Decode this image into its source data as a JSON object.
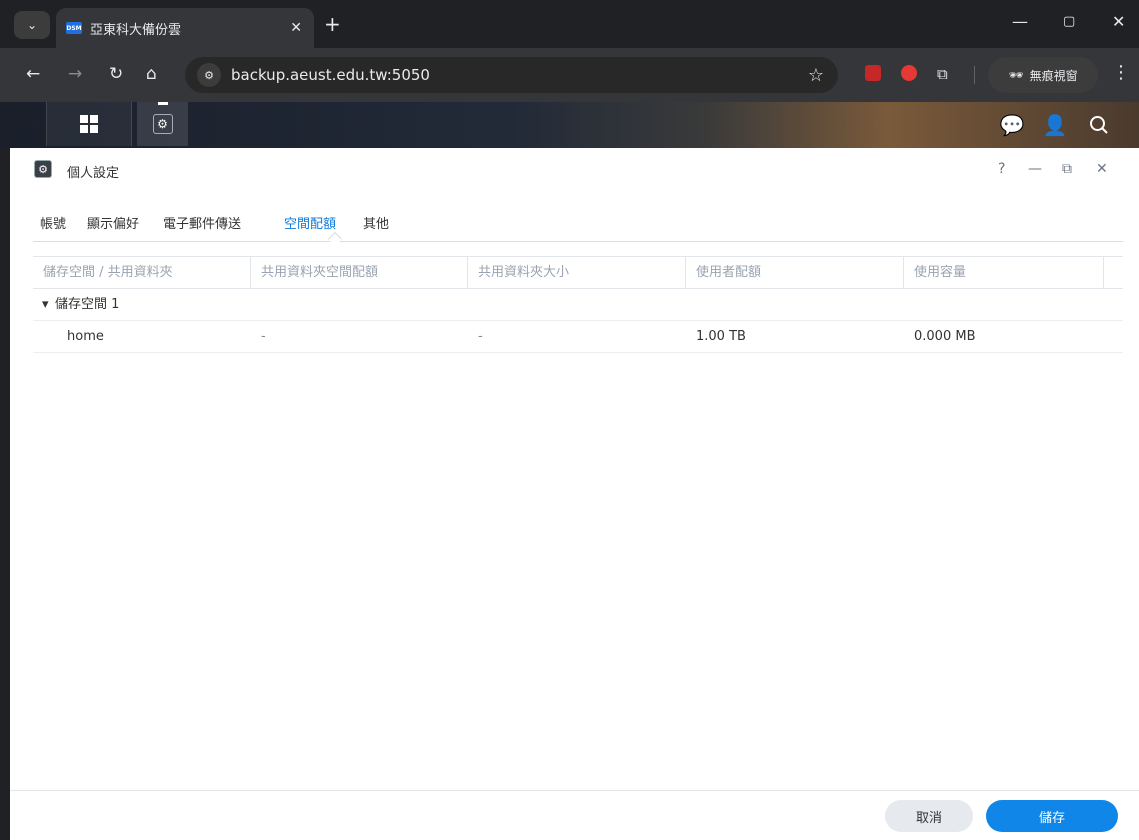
{
  "browser": {
    "tab_favicon": "DSM",
    "tab_title": "亞東科大備份雲",
    "tab_close": "✕",
    "new_tab": "+",
    "url": "backup.aeust.edu.tw:5050",
    "incognito_label": "無痕視窗"
  },
  "dsm_window": {
    "title": "個人設定",
    "help": "?",
    "tabs": [
      "帳號",
      "顯示偏好",
      "電子郵件傳送",
      "空間配額",
      "其他"
    ],
    "active_tab": "空間配額",
    "columns": [
      "儲存空間 / 共用資料夾",
      "共用資料夾空間配額",
      "共用資料夾大小",
      "使用者配額",
      "使用容量"
    ],
    "group": {
      "label": "儲存空間 1",
      "rows": [
        {
          "name": "home",
          "shared_quota": "-",
          "shared_size": "-",
          "user_quota": "1.00 TB",
          "used": "0.000 MB"
        }
      ]
    },
    "buttons": {
      "cancel": "取消",
      "save": "儲存"
    }
  },
  "colors": {
    "accent": "#0f86e8",
    "active_tab": "#0f7ad9"
  }
}
